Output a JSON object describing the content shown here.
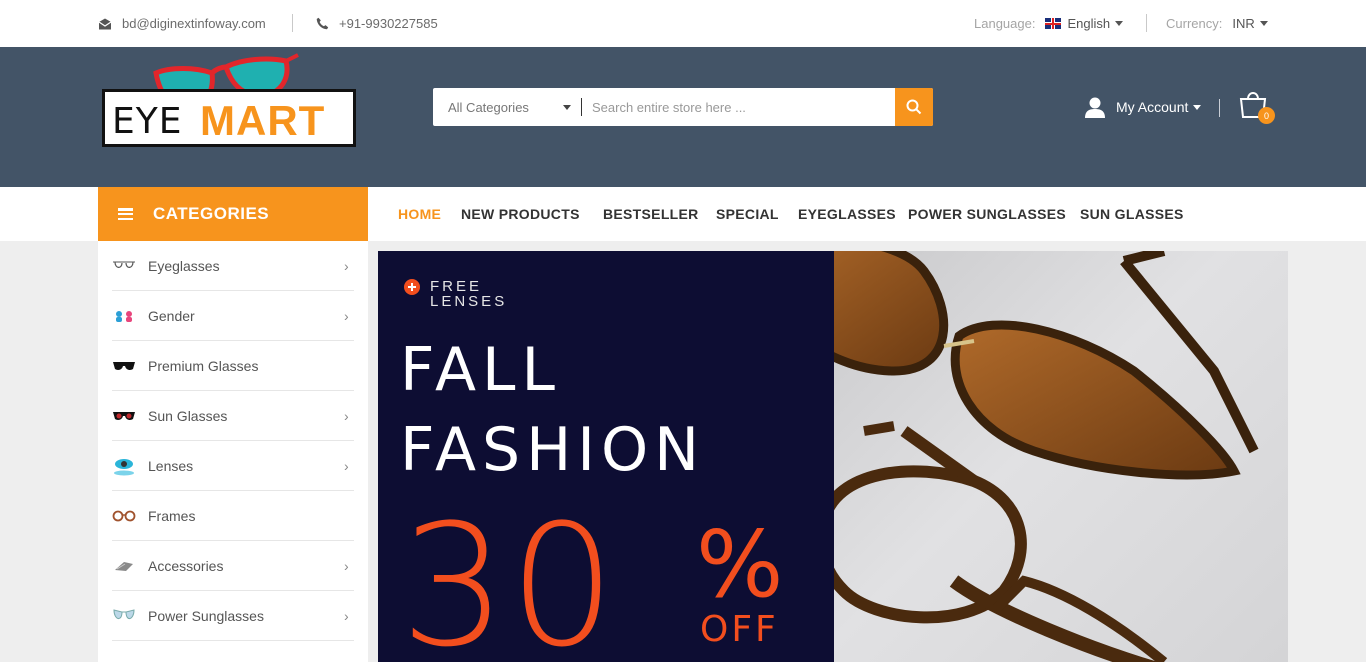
{
  "topbar": {
    "email": "bd@diginextinfoway.com",
    "phone": "+91-9930227585",
    "language_label": "Language:",
    "language_value": "English",
    "currency_label": "Currency:",
    "currency_value": "INR"
  },
  "header": {
    "logo_eye": "EYE",
    "logo_mart": "MART",
    "search_category": "All Categories",
    "search_placeholder": "Search entire store here ...",
    "account_label": "My Account",
    "cart_count": "0"
  },
  "nav": {
    "categories_title": "CATEGORIES",
    "menu": [
      "HOME",
      "NEW PRODUCTS",
      "BESTSELLER",
      "SPECIAL",
      "EYEGLASSES",
      "POWER SUNGLASSES",
      "SUN GLASSES"
    ]
  },
  "sidebar": {
    "items": [
      {
        "label": "Eyeglasses",
        "icon": "eyeglasses-icon",
        "has_sub": true
      },
      {
        "label": "Gender",
        "icon": "gender-icon",
        "has_sub": true
      },
      {
        "label": "Premium Glasses",
        "icon": "premium-glasses-icon",
        "has_sub": false
      },
      {
        "label": "Sun Glasses",
        "icon": "sunglasses-icon",
        "has_sub": true
      },
      {
        "label": "Lenses",
        "icon": "lenses-icon",
        "has_sub": true
      },
      {
        "label": "Frames",
        "icon": "frames-icon",
        "has_sub": false
      },
      {
        "label": "Accessories",
        "icon": "accessories-icon",
        "has_sub": true
      },
      {
        "label": "Power Sunglasses",
        "icon": "power-sunglasses-icon",
        "has_sub": true
      }
    ]
  },
  "banner": {
    "free_line1": "FREE",
    "free_line2": "LENSES",
    "line1": "FALL",
    "line2": "FASHION",
    "discount": "30",
    "percent": "%",
    "off": "OFF"
  },
  "colors": {
    "accent": "#f7941d",
    "header_bg": "#435467",
    "banner_dark": "#0d0d33",
    "banner_orange": "#f24e1e"
  }
}
